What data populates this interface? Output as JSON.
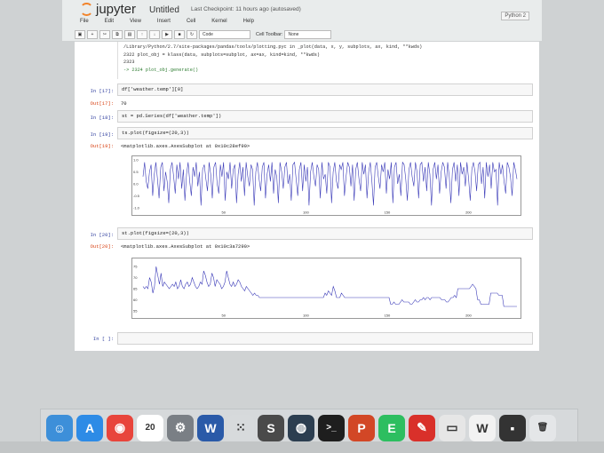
{
  "header": {
    "logo": "jupyter",
    "title": "Untitled",
    "checkpoint": "Last Checkpoint: 11 hours ago (autosaved)",
    "kernel": "Python 2"
  },
  "menu": [
    "File",
    "Edit",
    "View",
    "Insert",
    "Cell",
    "Kernel",
    "Help"
  ],
  "toolbar": {
    "cell_type": "Code",
    "cell_toolbar_label": "Cell Toolbar:",
    "cell_toolbar_value": "None"
  },
  "traceback": [
    "/Library/Python/2.7/site-packages/pandas/tools/plotting.pyc in _plot(data, x, y, subplots, ax, kind, **kwds)",
    "   2322         plot_obj = klass(data, subplots=subplot, ax=ax, kind=kind, **kwds)",
    "   2323",
    "-> 2324     plot_obj.generate()"
  ],
  "cells": [
    {
      "prompt": "In [17]:",
      "code": "df['weather.temp'][0]"
    },
    {
      "prompt": "Out[17]:",
      "text": "70"
    },
    {
      "prompt": "In [18]:",
      "code": "st = pd.Series(df['weather.temp'])"
    },
    {
      "prompt": "In [19]:",
      "code": "ts.plot(figsize=(20,3))"
    },
    {
      "prompt": "Out[19]:",
      "text": "<matplotlib.axes.AxesSubplot at 0x10c28ef90>"
    },
    {
      "prompt": "In [20]:",
      "code": "st.plot(figsize=(20,3))"
    },
    {
      "prompt": "Out[20]:",
      "text": "<matplotlib.axes.AxesSubplot at 0x10c3a7290>"
    },
    {
      "prompt": "In [ ]:",
      "code": ""
    }
  ],
  "chart_data": [
    {
      "type": "line",
      "ylim": [
        -1.0,
        1.0
      ],
      "yticks": [
        "1.0",
        "0.5",
        "0.0",
        "-0.5",
        "-1.0"
      ],
      "xticks": [
        "50",
        "100",
        "150",
        "200"
      ],
      "xlim": [
        0,
        230
      ],
      "series": [
        {
          "values": [
            0.3,
            0.9,
            0.1,
            -0.2,
            0.5,
            0.8,
            -0.5,
            0.4,
            0.9,
            0.2,
            -0.6,
            0.7,
            0.9,
            -0.3,
            0.5,
            0.1,
            -0.8,
            0.6,
            0.9,
            0.3,
            -0.4,
            0.8,
            0.2,
            0.9,
            -0.2,
            0.6,
            -0.7,
            0.4,
            0.9,
            0.1,
            -0.5,
            0.7,
            0.3,
            0.9,
            -0.1,
            0.5,
            -0.9,
            0.6,
            0.8,
            0.2,
            -0.3,
            0.9,
            0.4,
            -0.6,
            0.7,
            0.9,
            0.0,
            -0.4,
            0.8,
            0.3,
            0.9,
            -0.7,
            0.5,
            0.2,
            0.9,
            -0.2,
            0.6,
            0.8,
            -0.8,
            0.4,
            0.9,
            0.1,
            0.7,
            -0.5,
            0.9,
            0.3,
            -0.1,
            0.8,
            0.6,
            -0.9,
            0.5,
            0.9,
            0.2,
            -0.3,
            0.7,
            0.9,
            -0.6,
            0.4,
            0.8,
            0.1,
            0.9,
            -0.4,
            0.6,
            0.3,
            -0.8,
            0.9,
            0.5,
            -0.2,
            0.7,
            0.9,
            0.0,
            0.4,
            -0.7,
            0.8,
            0.9,
            0.2,
            -0.5,
            0.6,
            0.9,
            -0.3,
            0.8,
            0.1,
            0.7,
            -0.9,
            0.5,
            0.9,
            0.3,
            -0.1,
            0.8,
            0.6,
            -0.6,
            0.9,
            0.2,
            0.4,
            -0.4,
            0.9,
            0.7,
            -0.8,
            0.5,
            0.9,
            0.1,
            -0.2,
            0.8,
            0.6,
            0.9,
            -0.5,
            0.3,
            0.9,
            0.7,
            -0.1,
            0.8,
            -0.7,
            0.6,
            0.9,
            0.2,
            -0.3,
            0.9,
            0.4,
            0.8,
            -0.6,
            0.5,
            0.9,
            0.1,
            -0.9,
            0.7,
            0.9,
            0.3,
            -0.2,
            0.8,
            0.5,
            0.9,
            -0.4,
            0.6,
            0.2,
            0.9,
            -0.8,
            0.7,
            0.9,
            0.0,
            0.4,
            -0.5,
            0.9,
            0.8,
            0.2,
            -0.7,
            0.6,
            0.9,
            0.3,
            -0.1,
            0.9,
            0.5,
            -0.6,
            0.8,
            0.9,
            0.1,
            0.7,
            -0.3,
            0.9,
            0.4,
            -0.9,
            0.6,
            0.9,
            0.2,
            0.8,
            -0.4,
            0.5,
            0.9,
            0.7,
            -0.2,
            0.9,
            0.3,
            -0.8,
            0.6,
            0.9,
            0.1,
            0.8,
            -0.5,
            0.9,
            0.4,
            0.7,
            -0.1,
            0.9,
            0.2,
            -0.7,
            0.6,
            0.9,
            0.5,
            -0.3,
            0.8,
            0.9,
            0.0,
            0.7,
            -0.6,
            0.9,
            0.3,
            0.8,
            -0.2,
            0.9,
            0.5,
            0.6,
            -0.9,
            0.9,
            0.4,
            0.8,
            0.1,
            -0.4,
            0.9,
            0.7,
            0.3,
            -0.5,
            0.9,
            0.6,
            0.2
          ]
        }
      ]
    },
    {
      "type": "line",
      "ylim": [
        55,
        77
      ],
      "yticks": [
        "75",
        "70",
        "65",
        "60",
        "55"
      ],
      "xticks": [
        "50",
        "100",
        "150",
        "200"
      ],
      "xlim": [
        0,
        230
      ],
      "series": [
        {
          "values": [
            66,
            65,
            66,
            65,
            70,
            68,
            63,
            66,
            75,
            71,
            67,
            72,
            66,
            68,
            67,
            66,
            65,
            66,
            67,
            66,
            68,
            65,
            66,
            69,
            66,
            65,
            67,
            68,
            66,
            67,
            70,
            68,
            66,
            65,
            66,
            68,
            67,
            73,
            71,
            68,
            66,
            67,
            72,
            70,
            66,
            69,
            68,
            67,
            65,
            66,
            68,
            73,
            70,
            67,
            66,
            68,
            66,
            67,
            69,
            68,
            66,
            65,
            64,
            66,
            65,
            64,
            63,
            62,
            63,
            62,
            62,
            61,
            61,
            61,
            61,
            61,
            61,
            61,
            61,
            61,
            61,
            61,
            61,
            61,
            61,
            61,
            61,
            61,
            61,
            61,
            61,
            61,
            61,
            61,
            61,
            61,
            61,
            61,
            61,
            61,
            61,
            61,
            61,
            61,
            61,
            61,
            61,
            61,
            61,
            61,
            61,
            63,
            62,
            64,
            63,
            62,
            66,
            64,
            61,
            61,
            61,
            63,
            62,
            61,
            61,
            61,
            61,
            61,
            61,
            61,
            61,
            61,
            61,
            61,
            61,
            61,
            61,
            61,
            61,
            61,
            61,
            61,
            61,
            61,
            61,
            61,
            61,
            61,
            61,
            61,
            61,
            58,
            58,
            59,
            58,
            58,
            58,
            59,
            60,
            59,
            59,
            59,
            59,
            58,
            58,
            59,
            60,
            59,
            59,
            60,
            60,
            61,
            60,
            61,
            61,
            60,
            61,
            61,
            61,
            61,
            61,
            61,
            60,
            60,
            60,
            59,
            59,
            60,
            61,
            61,
            62,
            61,
            65,
            65,
            65,
            65,
            65,
            65,
            65,
            65,
            66,
            67,
            66,
            65,
            60,
            60,
            58,
            58,
            58,
            58,
            58,
            58,
            63,
            63,
            63,
            63,
            63,
            62,
            62,
            62,
            57,
            57,
            57,
            57,
            57,
            57,
            57,
            57,
            57
          ]
        }
      ]
    }
  ],
  "dock": [
    {
      "name": "finder-icon",
      "color": "#3d8fd9",
      "glyph": "☺"
    },
    {
      "name": "app-store-icon",
      "color": "#2d8be6",
      "glyph": "A"
    },
    {
      "name": "chrome-icon",
      "color": "#e8453c",
      "glyph": "◉"
    },
    {
      "name": "calendar-icon",
      "color": "#ffffff",
      "glyph": "20"
    },
    {
      "name": "system-preferences-icon",
      "color": "#7a7f85",
      "glyph": "⚙"
    },
    {
      "name": "word-icon",
      "color": "#2a5aa8",
      "glyph": "W"
    },
    {
      "name": "launchpad-grid-icon",
      "color": "#d7dadc",
      "glyph": "⁙"
    },
    {
      "name": "sublime-text-icon",
      "color": "#4a4a4a",
      "glyph": "S"
    },
    {
      "name": "messages-icon",
      "color": "#2c3e50",
      "glyph": "◍"
    },
    {
      "name": "terminal-icon",
      "color": "#1e1e1e",
      "glyph": ">_"
    },
    {
      "name": "powerpoint-icon",
      "color": "#d24726",
      "glyph": "P"
    },
    {
      "name": "evernote-icon",
      "color": "#2dbe60",
      "glyph": "E"
    },
    {
      "name": "slack-pen-icon",
      "color": "#d9302a",
      "glyph": "✎"
    },
    {
      "name": "window-thumbnail-icon",
      "color": "#e6e6e6",
      "glyph": "▭"
    },
    {
      "name": "word-document-icon",
      "color": "#f2f2f2",
      "glyph": "W"
    },
    {
      "name": "terminal-mini-icon",
      "color": "#333333",
      "glyph": "▪"
    },
    {
      "name": "trash-icon",
      "color": "#e4e6e8",
      "glyph": "🗑"
    }
  ]
}
